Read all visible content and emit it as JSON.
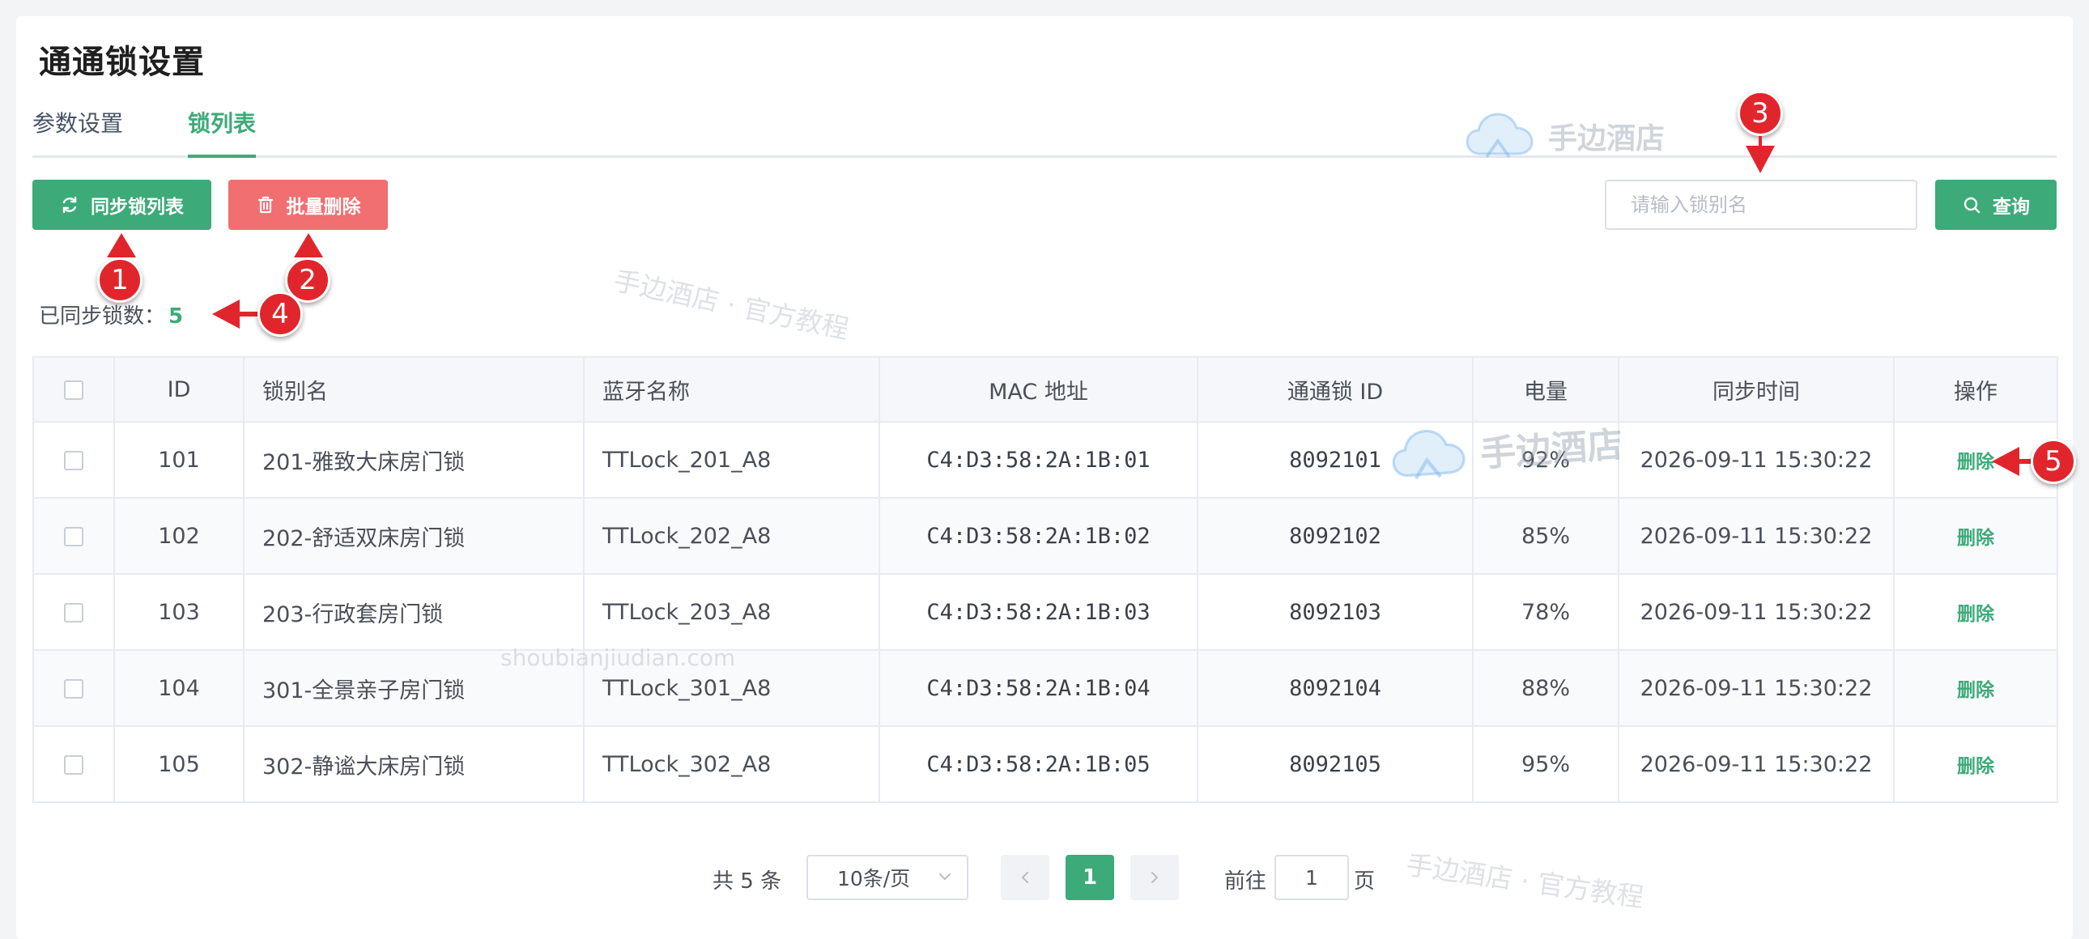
{
  "page": {
    "title": "通通锁设置"
  },
  "tabs": [
    {
      "label": "参数设置"
    },
    {
      "label": "锁列表"
    }
  ],
  "toolbar": {
    "sync_label": "同步锁列表",
    "batch_delete_label": "批量删除",
    "search_placeholder": "请输入锁别名",
    "search_value": "",
    "query_label": "查询"
  },
  "summary": {
    "label": "已同步锁数：",
    "count": "5"
  },
  "table": {
    "headers": {
      "id": "ID",
      "alias": "锁别名",
      "bt_name": "蓝牙名称",
      "mac": "MAC 地址",
      "lock_id": "通通锁 ID",
      "battery": "电量",
      "sync_time": "同步时间",
      "action": "操作"
    },
    "rows": [
      {
        "id": "101",
        "alias": "201-雅致大床房门锁",
        "bt_name": "TTLock_201_A8",
        "mac": "C4:D3:58:2A:1B:01",
        "lock_id": "8092101",
        "battery": "92%",
        "sync_time": "2026-09-11 15:30:22",
        "action": "删除"
      },
      {
        "id": "102",
        "alias": "202-舒适双床房门锁",
        "bt_name": "TTLock_202_A8",
        "mac": "C4:D3:58:2A:1B:02",
        "lock_id": "8092102",
        "battery": "85%",
        "sync_time": "2026-09-11 15:30:22",
        "action": "删除"
      },
      {
        "id": "103",
        "alias": "203-行政套房门锁",
        "bt_name": "TTLock_203_A8",
        "mac": "C4:D3:58:2A:1B:03",
        "lock_id": "8092103",
        "battery": "78%",
        "sync_time": "2026-09-11 15:30:22",
        "action": "删除"
      },
      {
        "id": "104",
        "alias": "301-全景亲子房门锁",
        "bt_name": "TTLock_301_A8",
        "mac": "C4:D3:58:2A:1B:04",
        "lock_id": "8092104",
        "battery": "88%",
        "sync_time": "2026-09-11 15:30:22",
        "action": "删除"
      },
      {
        "id": "105",
        "alias": "302-静谧大床房门锁",
        "bt_name": "TTLock_302_A8",
        "mac": "C4:D3:58:2A:1B:05",
        "lock_id": "8092105",
        "battery": "95%",
        "sync_time": "2026-09-11 15:30:22",
        "action": "删除"
      }
    ]
  },
  "pagination": {
    "total_text": "共 5 条",
    "page_size": "10条/页",
    "current_page": "1",
    "goto_label": "前往",
    "goto_value": "1",
    "page_unit": "页"
  },
  "annotations": [
    "1",
    "2",
    "3",
    "4",
    "5"
  ],
  "watermarks": {
    "logo_text": "手边酒店",
    "tutorial_text": "手边酒店 · 官方教程",
    "url_text": "shoubianjiudian.com"
  },
  "icons": {
    "sync": "refresh-icon",
    "batch_delete": "trash-icon",
    "query": "search-icon",
    "page_size": "chevron-down-icon",
    "prev": "chevron-left-icon",
    "next": "chevron-right-icon",
    "logo": "cloud-logo-icon"
  },
  "colors": {
    "primary": "#3daa79",
    "danger": "#f16e71",
    "annotation": "#e0262c"
  }
}
